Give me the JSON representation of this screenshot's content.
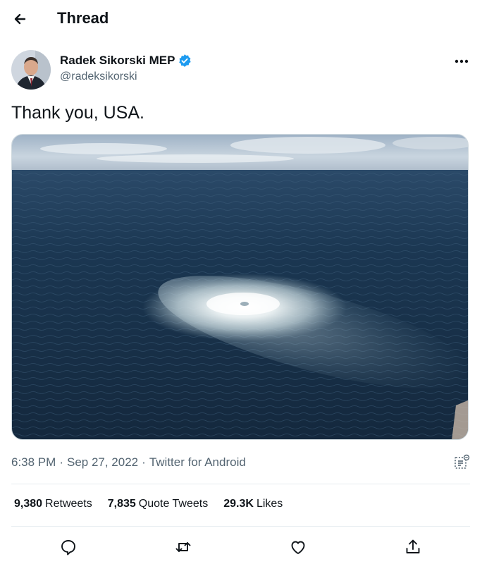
{
  "header": {
    "title": "Thread"
  },
  "tweet": {
    "author_name": "Radek Sikorski MEP",
    "author_handle": "@radeksikorski",
    "text": "Thank you, USA.",
    "time": "6:38 PM",
    "date": "Sep 27, 2022",
    "source": "Twitter for Android"
  },
  "stats": {
    "retweets_count": "9,380",
    "retweets_label": "Retweets",
    "quotes_count": "7,835",
    "quotes_label": "Quote Tweets",
    "likes_count": "29.3K",
    "likes_label": "Likes"
  },
  "colors": {
    "verified": "#1d9bf0",
    "text": "#0f1419",
    "secondary": "#536471"
  },
  "icons": [
    "back-arrow-icon",
    "verified-icon",
    "more-icon",
    "analytics-icon",
    "reply-icon",
    "retweet-icon",
    "like-icon",
    "share-icon"
  ]
}
